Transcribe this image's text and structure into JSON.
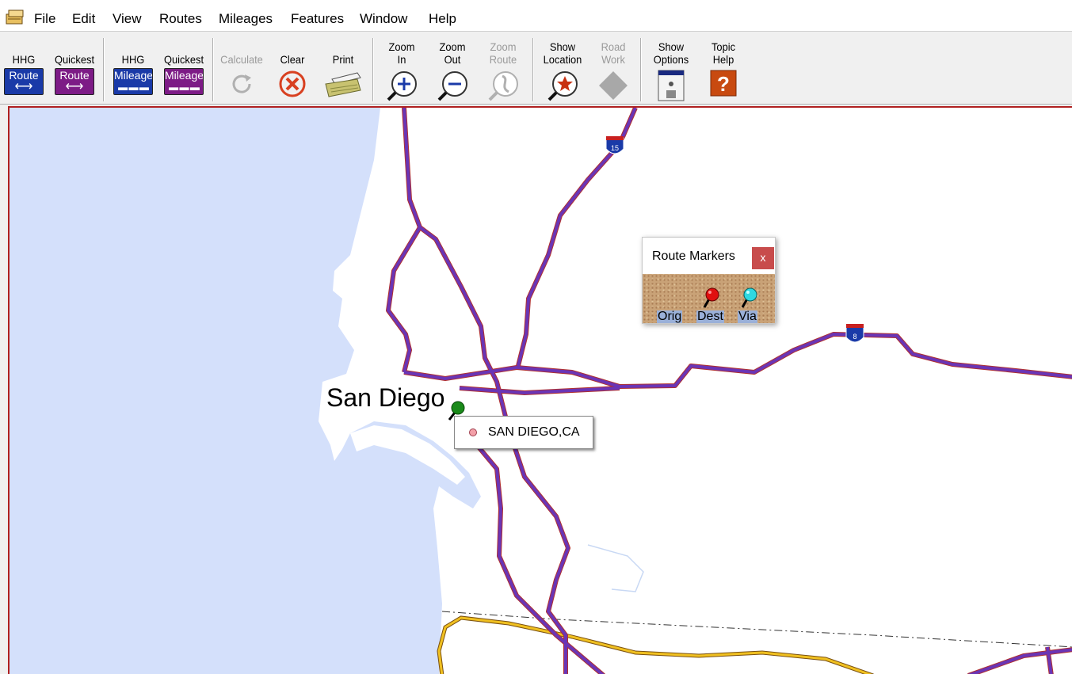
{
  "menu": {
    "items": [
      "File",
      "Edit",
      "View",
      "Routes",
      "Mileages",
      "Features",
      "Window",
      "Help"
    ]
  },
  "toolbar": {
    "hhg_route": {
      "line1": "HHG",
      "sign": "Route"
    },
    "quickest_route": {
      "line1": "Quickest",
      "sign": "Route"
    },
    "hhg_mileage": {
      "line1": "HHG",
      "sign": "Mileage"
    },
    "quickest_mileage": {
      "line1": "Quickest",
      "sign": "Mileage"
    },
    "calculate": {
      "label": "Calculate"
    },
    "clear": {
      "label": "Clear"
    },
    "print": {
      "label": "Print"
    },
    "zoom_in": {
      "line1": "Zoom",
      "line2": "In"
    },
    "zoom_out": {
      "line1": "Zoom",
      "line2": "Out"
    },
    "zoom_route": {
      "line1": "Zoom",
      "line2": "Route"
    },
    "show_location": {
      "line1": "Show",
      "line2": "Location"
    },
    "road_work": {
      "line1": "Road",
      "line2": "Work"
    },
    "show_options": {
      "line1": "Show",
      "line2": "Options"
    },
    "topic_help": {
      "line1": "Topic",
      "line2": "Help"
    }
  },
  "map": {
    "city_label": "San Diego",
    "tooltip": "SAN DIEGO,CA",
    "shields": {
      "i15": "15",
      "i8": "8"
    }
  },
  "route_markers": {
    "title": "Route Markers",
    "close": "x",
    "orig": "Orig",
    "dest": "Dest",
    "via": "Via"
  },
  "colors": {
    "water": "#d4e0fb",
    "highway": "#6a35b5",
    "highway_edge": "#b03030",
    "border_road": "#e8b020",
    "route_sign_blue": "#1a3aa8",
    "route_sign_purple": "#7d1b86"
  }
}
